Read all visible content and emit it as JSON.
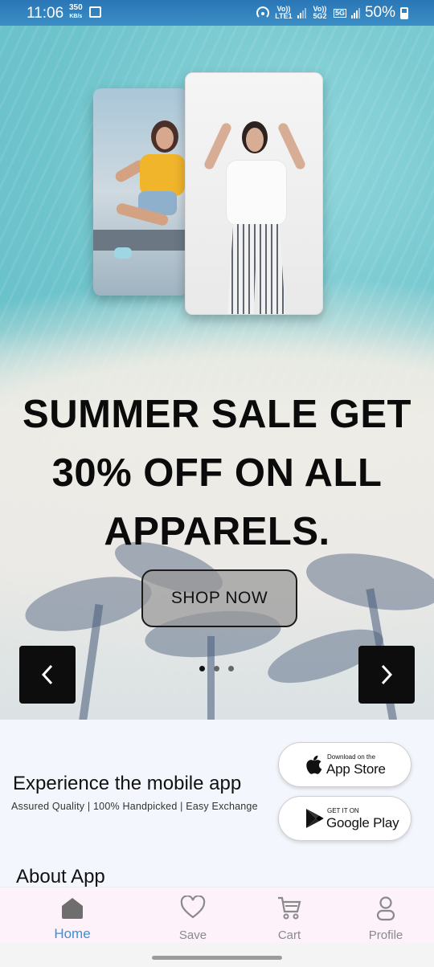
{
  "status_bar": {
    "time": "11:06",
    "net_speed_value": "350",
    "net_speed_unit": "KB/s",
    "sim1_label": "Vo)) LTE1",
    "sim2_label": "Vo)) 5G2",
    "network_type": "5G",
    "battery": "50%"
  },
  "hero": {
    "headline": "SUMMER SALE GET 30% OFF ON ALL APPARELS.",
    "cta_label": "SHOP NOW",
    "carousel_slides": 3,
    "carousel_active_index": 0
  },
  "promo": {
    "title": "Experience the mobile app",
    "subtitle": "Assured Quality | 100% Handpicked | Easy Exchange",
    "app_store_small": "Download on the",
    "app_store_big": "App Store",
    "google_play_small": "GET IT ON",
    "google_play_big": "Google Play"
  },
  "about": {
    "title": "About App"
  },
  "bottom_nav": {
    "items": [
      {
        "label": "Home",
        "icon": "home-icon",
        "active": true
      },
      {
        "label": "Save",
        "icon": "heart-icon",
        "active": false
      },
      {
        "label": "Cart",
        "icon": "cart-icon",
        "active": false
      },
      {
        "label": "Profile",
        "icon": "profile-icon",
        "active": false
      }
    ]
  },
  "colors": {
    "accent": "#3b8fd4",
    "status_bar": "#2a76b6",
    "nav_bg": "#fdf1fa",
    "arrow_bg": "#0d0d0d"
  }
}
